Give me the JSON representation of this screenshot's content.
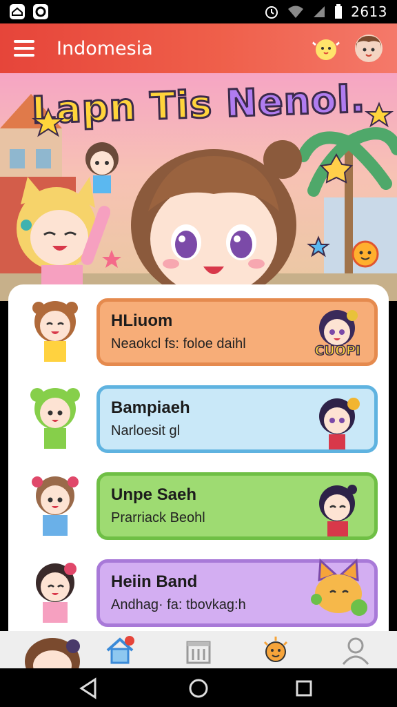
{
  "status_bar": {
    "time": "2613",
    "icons": [
      "notification-icon",
      "app-icon",
      "alarm-icon",
      "wifi-icon",
      "signal-icon",
      "battery-icon"
    ]
  },
  "app_bar": {
    "title": "Indomesia",
    "menu_icon": "menu-icon",
    "right_icons": [
      "chick-mascot-icon",
      "profile-avatar"
    ]
  },
  "hero": {
    "title_part1": "Lapn Tis ",
    "title_part2": "Nenol."
  },
  "list": [
    {
      "title": "HLiuom",
      "subtitle": "Neaokcl fs: foloe daihl",
      "color": "#f7ad78",
      "border": "#e58a4e",
      "badge": "CUOPI"
    },
    {
      "title": "Bampiaeh",
      "subtitle": "Narloesit gl",
      "color": "#c9e8f8",
      "border": "#5fb3e0",
      "badge": ""
    },
    {
      "title": "Unpe Saeh",
      "subtitle": "Prarriack Beohl",
      "color": "#9edb72",
      "border": "#6fbf45",
      "badge": ""
    },
    {
      "title": "Heiin Band",
      "subtitle": "Andhag· fa: tbovkag:h",
      "color": "#d3aef2",
      "border": "#a879d8",
      "badge": ""
    }
  ],
  "bottom_nav": [
    "avatar-nav",
    "home-icon",
    "store-icon",
    "sun-mascot-icon",
    "profile-icon"
  ],
  "system_nav": [
    "back-icon",
    "home-circle-icon",
    "recents-icon"
  ],
  "colors": {
    "accent": "#e6453a",
    "title_yellow": "#ffd43b",
    "title_purple": "#b07cf0"
  }
}
